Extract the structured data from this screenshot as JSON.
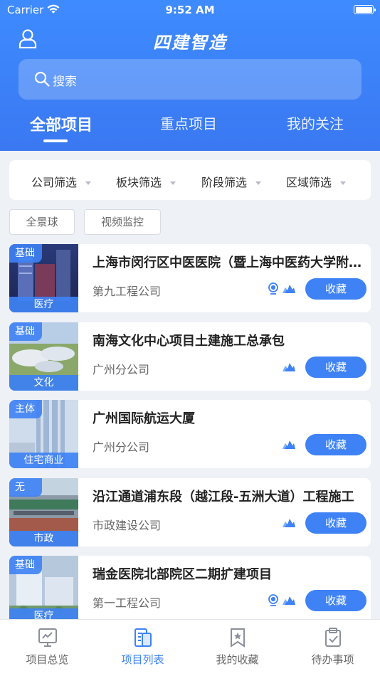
{
  "status_bar": {
    "carrier": "Carrier",
    "time": "9:52 AM"
  },
  "app": {
    "title": "四建智造"
  },
  "search": {
    "placeholder": "搜索"
  },
  "tabs": [
    {
      "label": "全部项目",
      "active": true
    },
    {
      "label": "重点项目",
      "active": false
    },
    {
      "label": "我的关注",
      "active": false
    }
  ],
  "filters": [
    {
      "label": "公司筛选"
    },
    {
      "label": "板块筛选"
    },
    {
      "label": "阶段筛选"
    },
    {
      "label": "区域筛选"
    }
  ],
  "chips": [
    {
      "label": "全景球"
    },
    {
      "label": "视频监控"
    }
  ],
  "projects": [
    {
      "stage": "基础",
      "category": "医疗",
      "title": "上海市闵行区中医医院（暨上海中医药大学附属闵行中医医院）",
      "company": "第九工程公司",
      "has_camera": true,
      "has_panorama": true,
      "action": "收藏"
    },
    {
      "stage": "基础",
      "category": "文化",
      "title": "南海文化中心项目土建施工总承包",
      "company": "广州分公司",
      "has_camera": false,
      "has_panorama": true,
      "action": "收藏"
    },
    {
      "stage": "主体",
      "category": "住宅商业",
      "title": "广州国际航运大厦",
      "company": "广州分公司",
      "has_camera": false,
      "has_panorama": true,
      "action": "收藏"
    },
    {
      "stage": "无",
      "category": "市政",
      "title": "沿江通道浦东段（越江段-五洲大道）工程施工",
      "company": "市政建设公司",
      "has_camera": false,
      "has_panorama": true,
      "action": "收藏"
    },
    {
      "stage": "基础",
      "category": "医疗",
      "title": "瑞金医院北部院区二期扩建项目",
      "company": "第一工程公司",
      "has_camera": true,
      "has_panorama": true,
      "action": "收藏"
    }
  ],
  "tabbar": [
    {
      "label": "项目总览",
      "icon": "chart-board-icon",
      "active": false
    },
    {
      "label": "项目列表",
      "icon": "doc-list-icon",
      "active": true
    },
    {
      "label": "我的收藏",
      "icon": "bookmark-star-icon",
      "active": false
    },
    {
      "label": "待办事项",
      "icon": "clipboard-check-icon",
      "active": false
    }
  ],
  "colors": {
    "accent": "#3e82f6",
    "header_top": "#3e8bff",
    "background": "#eef1f6"
  }
}
